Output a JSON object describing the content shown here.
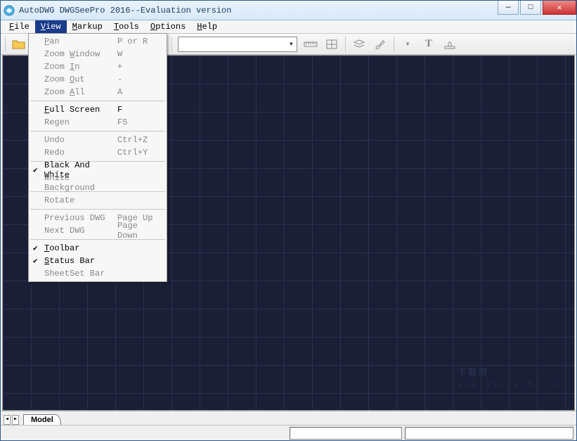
{
  "title": "AutoDWG DWGSeePro 2016--Evaluation version",
  "menubar": [
    "File",
    "View",
    "Markup",
    "Tools",
    "Options",
    "Help"
  ],
  "menubar_active_index": 1,
  "view_menu": {
    "groups": [
      [
        {
          "label": "Pan",
          "ul": 0,
          "shortcut": "P or R",
          "enabled": false
        },
        {
          "label": "Zoom Window",
          "ul": 5,
          "shortcut": "W",
          "enabled": false
        },
        {
          "label": "Zoom In",
          "ul": 5,
          "shortcut": "+",
          "enabled": false
        },
        {
          "label": "Zoom Out",
          "ul": 5,
          "shortcut": "-",
          "enabled": false
        },
        {
          "label": "Zoom All",
          "ul": 5,
          "shortcut": "A",
          "enabled": false
        }
      ],
      [
        {
          "label": "Full Screen",
          "ul": 0,
          "shortcut": "F",
          "enabled": true
        },
        {
          "label": "Regen",
          "shortcut": "F5",
          "enabled": false
        }
      ],
      [
        {
          "label": "Undo",
          "shortcut": "Ctrl+Z",
          "enabled": false
        },
        {
          "label": "Redo",
          "shortcut": "Ctrl+Y",
          "enabled": false
        }
      ],
      [
        {
          "label": "Black And White",
          "enabled": true,
          "checked": true
        },
        {
          "label": "White Background",
          "enabled": false
        }
      ],
      [
        {
          "label": "Rotate",
          "enabled": false
        }
      ],
      [
        {
          "label": "Previous DWG",
          "shortcut": "Page Up",
          "enabled": false
        },
        {
          "label": "Next DWG",
          "shortcut": "Page Down",
          "enabled": false
        }
      ],
      [
        {
          "label": "Toolbar",
          "ul": 0,
          "enabled": true,
          "checked": true
        },
        {
          "label": "Status Bar",
          "ul": 0,
          "enabled": true,
          "checked": true
        },
        {
          "label": "SheetSet Bar",
          "enabled": false
        }
      ]
    ]
  },
  "toolbar_icons": [
    "open-file-icon",
    "hand-pan-icon",
    "zoom-window-icon",
    "zoom-out-icon",
    "zoom-in-icon",
    "zoom-extents-icon",
    "page-icon",
    "combo",
    "measure-icon",
    "measure-area-icon",
    "layers-icon",
    "brush-icon",
    "arrow-down-icon",
    "text-icon",
    "stamp-icon"
  ],
  "tabs": {
    "active": "Model"
  },
  "watermark": {
    "main": "下载吧",
    "sub": "www.xiazaiba.com"
  }
}
